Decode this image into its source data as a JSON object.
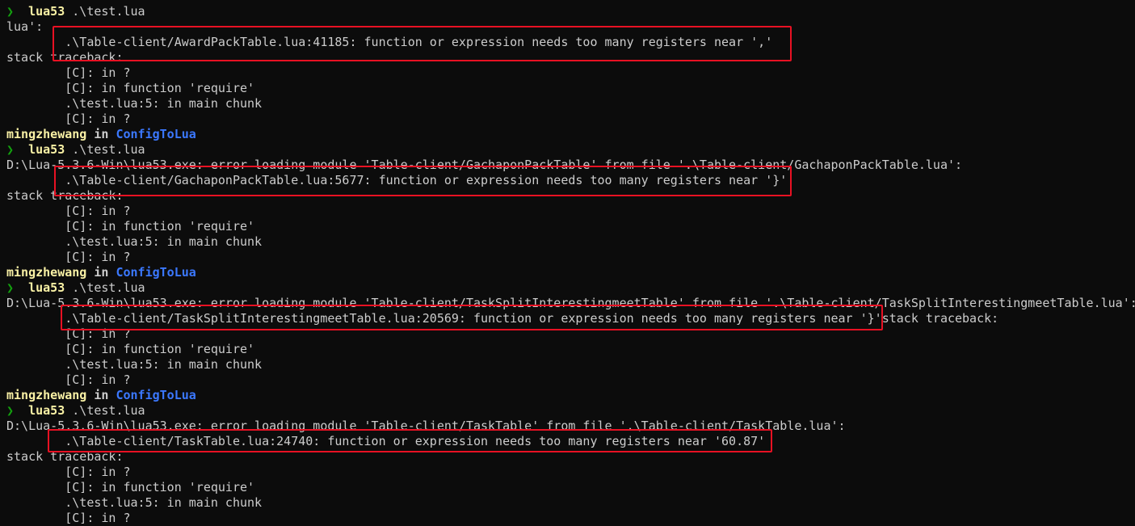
{
  "prompt_symbol": "❯",
  "session": {
    "user": "mingzhewang",
    "in_word": "in",
    "dir": "ConfigToLua",
    "command": "lua53",
    "command_arg": ".\\test.lua"
  },
  "runs": [
    {
      "error_line": "lua':",
      "detail": "        .\\Table-client/AwardPackTable.lua:41185: function or expression needs too many registers near ','",
      "traceback_header": "stack traceback:",
      "traceback": [
        "        [C]: in ?",
        "        [C]: in function 'require'",
        "        .\\test.lua:5: in main chunk",
        "        [C]: in ?"
      ]
    },
    {
      "error_line": "D:\\Lua-5.3.6-Win\\lua53.exe: error loading module 'Table-client/GachaponPackTable' from file '.\\Table-client/GachaponPackTable.lua':",
      "detail": "        .\\Table-client/GachaponPackTable.lua:5677: function or expression needs too many registers near '}'",
      "traceback_header": "stack traceback:",
      "traceback": [
        "        [C]: in ?",
        "        [C]: in function 'require'",
        "        .\\test.lua:5: in main chunk",
        "        [C]: in ?"
      ]
    },
    {
      "error_line": "D:\\Lua-5.3.6-Win\\lua53.exe: error loading module 'Table-client/TaskSplitInterestingmeetTable' from file '.\\Table-client/TaskSplitInterestingmeetTable.lua':",
      "detail": "        .\\Table-client/TaskSplitInterestingmeetTable.lua:20569: function or expression needs too many registers near '}'stack traceback:",
      "traceback": [
        "        [C]: in ?",
        "        [C]: in function 'require'",
        "        .\\test.lua:5: in main chunk",
        "        [C]: in ?"
      ]
    },
    {
      "error_line": "D:\\Lua-5.3.6-Win\\lua53.exe: error loading module 'Table-client/TaskTable' from file '.\\Table-client/TaskTable.lua':",
      "detail": "        .\\Table-client/TaskTable.lua:24740: function or expression needs too many registers near '60.87'",
      "traceback_header": "stack traceback:",
      "traceback": [
        "        [C]: in ?",
        "        [C]: in function 'require'",
        "        .\\test.lua:5: in main chunk",
        "        [C]: in ?"
      ]
    }
  ],
  "colors": {
    "background": "#0c0c0c",
    "text": "#cccccc",
    "prompt_arrow": "#13a10e",
    "command": "#f9f1a5",
    "directory": "#3b78ff",
    "highlight_box": "#e81123"
  }
}
